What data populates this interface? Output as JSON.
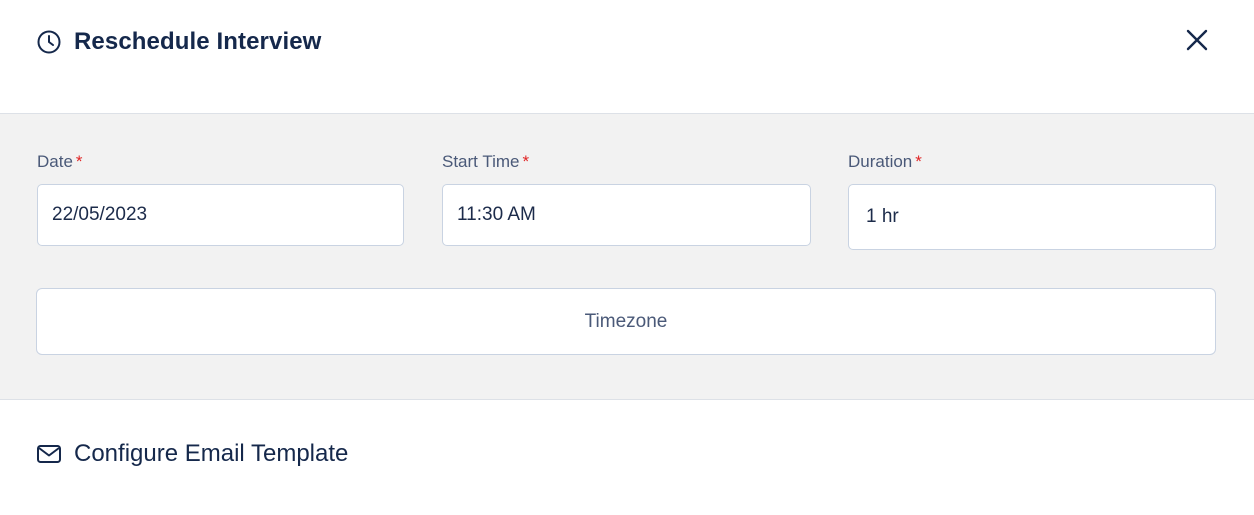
{
  "header": {
    "title": "Reschedule Interview",
    "icon": "clock-icon",
    "close_icon": "close-icon"
  },
  "form": {
    "date": {
      "label": "Date",
      "required_mark": "*",
      "value": "22/05/2023"
    },
    "start_time": {
      "label": "Start Time",
      "required_mark": "*",
      "value": "11:30 AM"
    },
    "duration": {
      "label": "Duration",
      "required_mark": "*",
      "value": "1 hr"
    },
    "timezone_label": "Timezone"
  },
  "email": {
    "label": "Configure Email Template",
    "icon": "mail-icon"
  },
  "colors": {
    "title_text": "#15284b",
    "required": "#e02424",
    "form_bg": "#f2f2f2",
    "input_border": "#c9d3e2"
  }
}
